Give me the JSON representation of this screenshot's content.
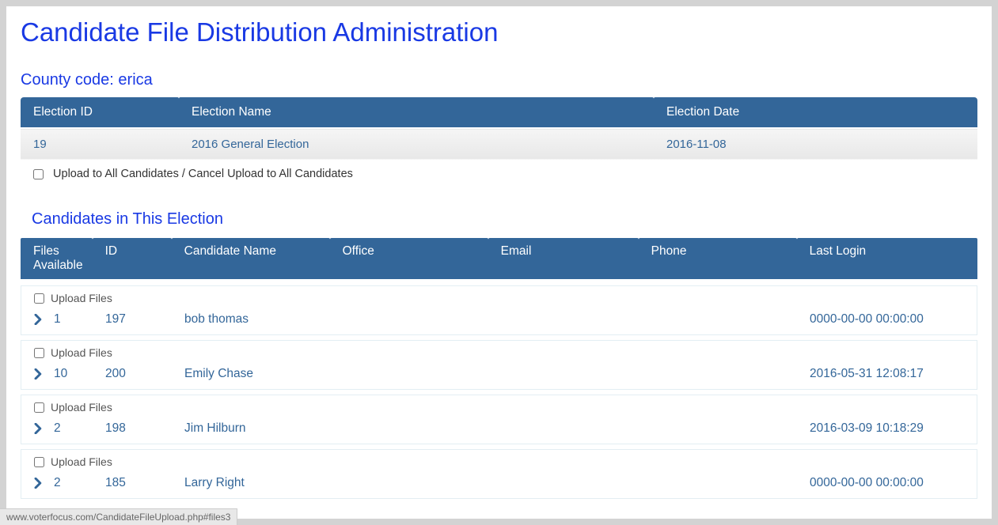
{
  "page_title": "Candidate File Distribution Administration",
  "county_label": "County code: erica",
  "election_table": {
    "headers": {
      "id": "Election ID",
      "name": "Election Name",
      "date": "Election Date"
    },
    "row": {
      "id": "19",
      "name": "2016 General Election",
      "date": "2016-11-08"
    }
  },
  "upload_all_label": "Upload to All Candidates / Cancel Upload to All Candidates",
  "candidates_section_title": "Candidates in This Election",
  "candidates_table": {
    "headers": {
      "files": "Files Available",
      "id": "ID",
      "name": "Candidate Name",
      "office": "Office",
      "email": "Email",
      "phone": "Phone",
      "login": "Last Login"
    },
    "upload_label": "Upload Files",
    "rows": [
      {
        "files": "1",
        "id": "197",
        "name": "bob thomas",
        "office": "",
        "email": "",
        "phone": "",
        "login": "0000-00-00 00:00:00"
      },
      {
        "files": "10",
        "id": "200",
        "name": "Emily Chase",
        "office": "",
        "email": "",
        "phone": "",
        "login": "2016-05-31 12:08:17"
      },
      {
        "files": "2",
        "id": "198",
        "name": "Jim Hilburn",
        "office": "",
        "email": "",
        "phone": "",
        "login": "2016-03-09 10:18:29"
      },
      {
        "files": "2",
        "id": "185",
        "name": "Larry Right",
        "office": "",
        "email": "",
        "phone": "",
        "login": "0000-00-00 00:00:00"
      }
    ]
  },
  "status_url": "www.voterfocus.com/CandidateFileUpload.php#files3"
}
